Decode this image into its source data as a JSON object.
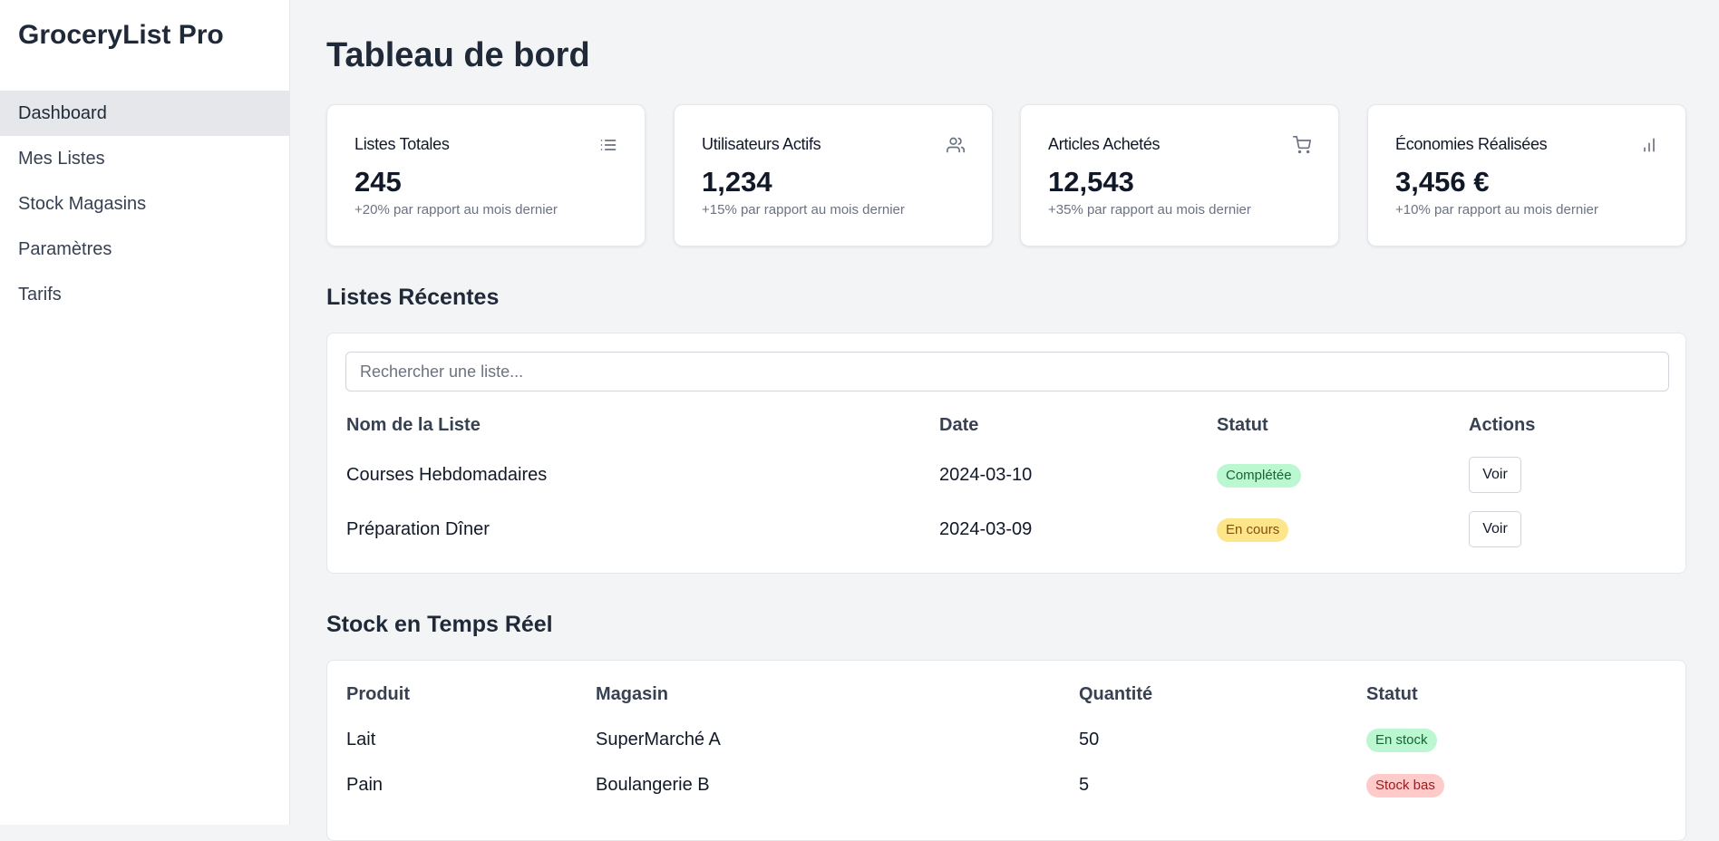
{
  "app": {
    "title": "GroceryList Pro"
  },
  "sidebar": {
    "items": [
      {
        "label": "Dashboard",
        "active": true
      },
      {
        "label": "Mes Listes"
      },
      {
        "label": "Stock Magasins"
      },
      {
        "label": "Paramètres"
      },
      {
        "label": "Tarifs"
      }
    ]
  },
  "page": {
    "title": "Tableau de bord"
  },
  "stats": [
    {
      "title": "Listes Totales",
      "value": "245",
      "change": "+20% par rapport au mois dernier",
      "icon": "list-icon"
    },
    {
      "title": "Utilisateurs Actifs",
      "value": "1,234",
      "change": "+15% par rapport au mois dernier",
      "icon": "users-icon"
    },
    {
      "title": "Articles Achetés",
      "value": "12,543",
      "change": "+35% par rapport au mois dernier",
      "icon": "cart-icon"
    },
    {
      "title": "Économies Réalisées",
      "value": "3,456 €",
      "change": "+10% par rapport au mois dernier",
      "icon": "bar-chart-icon"
    }
  ],
  "recent_lists": {
    "title": "Listes Récentes",
    "search_placeholder": "Rechercher une liste...",
    "columns": [
      "Nom de la Liste",
      "Date",
      "Statut",
      "Actions"
    ],
    "rows": [
      {
        "name": "Courses Hebdomadaires",
        "date": "2024-03-10",
        "status": "Complétée",
        "action": "Voir"
      },
      {
        "name": "Préparation Dîner",
        "date": "2024-03-09",
        "status": "En cours",
        "action": "Voir"
      }
    ]
  },
  "stock": {
    "title": "Stock en Temps Réel",
    "columns": [
      "Produit",
      "Magasin",
      "Quantité",
      "Statut"
    ],
    "rows": [
      {
        "product": "Lait",
        "store": "SuperMarché A",
        "quantity": "50",
        "status": "En stock"
      },
      {
        "product": "Pain",
        "store": "Boulangerie B",
        "quantity": "5",
        "status": "Stock bas"
      }
    ]
  },
  "colors": {
    "background": "#f3f4f6",
    "sidebar_active": "#e5e7eb",
    "badge_complete": "#bbf7d0",
    "badge_in_progress": "#fde68a",
    "badge_low_stock": "#fecaca"
  }
}
